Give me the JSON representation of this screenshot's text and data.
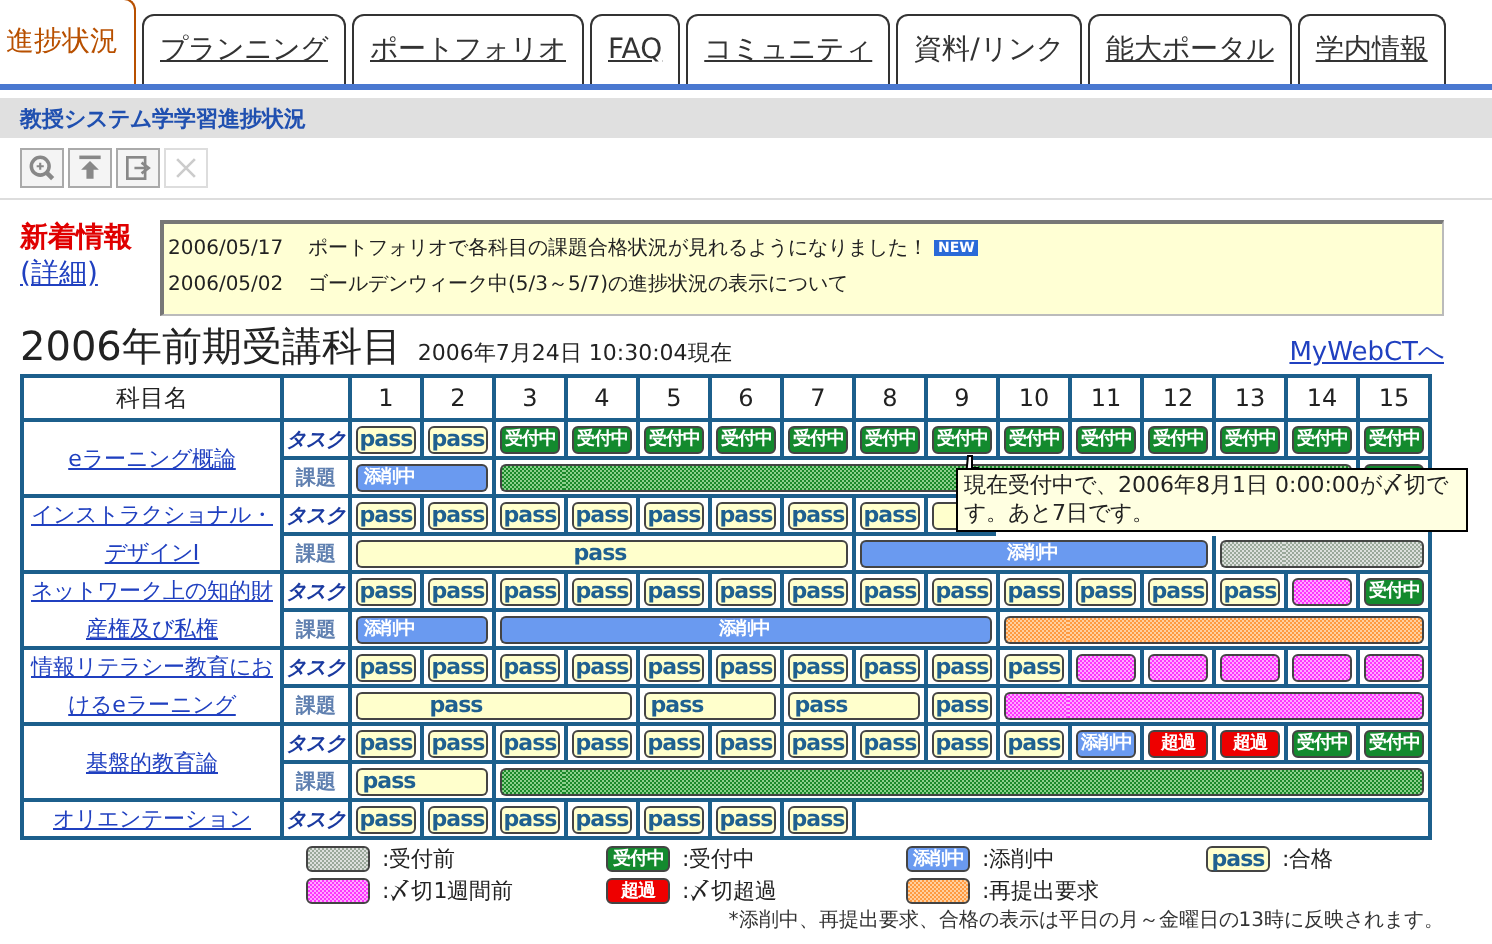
{
  "tabs": [
    {
      "label": "進捗状況",
      "selected": true,
      "linked": false
    },
    {
      "label": "プランニング",
      "selected": false,
      "linked": true
    },
    {
      "label": "ポートフォリオ",
      "selected": false,
      "linked": true
    },
    {
      "label": "FAQ",
      "selected": false,
      "linked": true
    },
    {
      "label": "コミュニティ",
      "selected": false,
      "linked": true
    },
    {
      "label": "資料/リンク",
      "selected": false,
      "linked": false
    },
    {
      "label": "能大ポータル",
      "selected": false,
      "linked": true
    },
    {
      "label": "学内情報",
      "selected": false,
      "linked": true
    }
  ],
  "header": {
    "title": "教授システム学学習進捗状況"
  },
  "toolbar": [
    {
      "kind": "zoom",
      "disabled": false
    },
    {
      "kind": "top",
      "disabled": false
    },
    {
      "kind": "export",
      "disabled": false
    },
    {
      "kind": "delete",
      "disabled": true
    }
  ],
  "news": {
    "title": "新着情報",
    "detail_link": "(詳細)",
    "items": [
      {
        "date": "2006/05/17",
        "text": "ポートフォリオで各科目の課題合格状況が見れるようになりました！",
        "badge": "NEW"
      },
      {
        "date": "2006/05/02",
        "text": "ゴールデンウィーク中(5/3～5/7)の進捗状況の表示について"
      }
    ]
  },
  "heading": {
    "title": "2006年前期受講科目",
    "timestamp": "2006年7月24日 10:30:04現在",
    "link": "MyWebCTへ"
  },
  "table": {
    "subject_header": "科目名",
    "weeks": [
      "1",
      "2",
      "3",
      "4",
      "5",
      "6",
      "7",
      "8",
      "9",
      "10",
      "11",
      "12",
      "13",
      "14",
      "15"
    ],
    "subjects": [
      {
        "name": "eラーニング概論",
        "rows": [
          {
            "kind": "task",
            "label": "タスク",
            "cells": [
              {
                "kind": "pass",
                "label": "pass",
                "joined": false
              },
              {
                "kind": "pass",
                "label": "pass",
                "joined": false
              },
              {
                "kind": "open",
                "label": "受付中",
                "joined": false
              },
              {
                "kind": "open",
                "label": "受付中",
                "joined": false
              },
              {
                "kind": "open",
                "label": "受付中",
                "joined": false
              },
              {
                "kind": "open",
                "label": "受付中",
                "joined": false
              },
              {
                "kind": "open",
                "label": "受付中",
                "joined": false
              },
              {
                "kind": "open",
                "label": "受付中",
                "joined": false
              },
              {
                "kind": "open",
                "label": "受付中",
                "joined": false
              },
              {
                "kind": "open",
                "label": "受付中",
                "joined": false
              },
              {
                "kind": "open",
                "label": "受付中",
                "joined": false
              },
              {
                "kind": "open",
                "label": "受付中",
                "joined": false
              },
              {
                "kind": "open",
                "label": "受付中",
                "joined": false
              },
              {
                "kind": "open",
                "label": "受付中",
                "joined": false
              },
              {
                "kind": "open",
                "label": "受付中",
                "joined": false
              }
            ]
          },
          {
            "kind": "assignment",
            "label": "課題",
            "cells": [
              {
                "kind": "grading",
                "label": "添削中",
                "joined": false
              },
              {
                "kind": "grading",
                "joined": true
              },
              {
                "kind": "open-period",
                "joined": false
              },
              {
                "kind": "open-period",
                "joined": true
              },
              {
                "kind": "open-period",
                "joined": true
              },
              {
                "kind": "open-period",
                "joined": true
              },
              {
                "kind": "open-period",
                "joined": true
              },
              {
                "kind": "open-period",
                "joined": true
              },
              {
                "kind": "open-period",
                "joined": true
              },
              {
                "kind": "open-period",
                "joined": true
              },
              {
                "kind": "open-period",
                "joined": true
              },
              {
                "kind": "open-period",
                "joined": true
              },
              {
                "kind": "open-period",
                "joined": true
              },
              {
                "kind": "open-period",
                "joined": true
              },
              {
                "kind": "open",
                "joined": false
              }
            ]
          }
        ]
      },
      {
        "name": "インストラクショナル・デザインⅠ",
        "rows": [
          {
            "kind": "task",
            "label": "タスク",
            "cells": [
              {
                "kind": "pass",
                "label": "pass",
                "joined": false
              },
              {
                "kind": "pass",
                "label": "pass",
                "joined": false
              },
              {
                "kind": "pass",
                "label": "pass",
                "joined": false
              },
              {
                "kind": "pass",
                "label": "pass",
                "joined": false
              },
              {
                "kind": "pass",
                "label": "pass",
                "joined": false
              },
              {
                "kind": "pass",
                "label": "pass",
                "joined": false
              },
              {
                "kind": "pass",
                "label": "pass",
                "joined": false
              },
              {
                "kind": "pass",
                "label": "pass",
                "joined": false
              },
              {
                "kind": "pass",
                "joined": false
              }
            ]
          },
          {
            "kind": "assignment",
            "label": "課題",
            "cells": [
              {
                "kind": "pass",
                "joined": false
              },
              {
                "kind": "pass",
                "joined": true
              },
              {
                "kind": "pass",
                "joined": true
              },
              {
                "kind": "pass",
                "label": "pass",
                "joined": true
              },
              {
                "kind": "pass",
                "joined": true
              },
              {
                "kind": "pass",
                "joined": true
              },
              {
                "kind": "pass",
                "joined": true
              },
              {
                "kind": "grading",
                "joined": false
              },
              {
                "kind": "grading",
                "joined": true
              },
              {
                "kind": "grading",
                "label": "添削中",
                "joined": true
              },
              {
                "kind": "grading",
                "joined": true
              },
              {
                "kind": "grading",
                "joined": true
              },
              {
                "kind": "before",
                "joined": false
              },
              {
                "kind": "before",
                "joined": true
              },
              {
                "kind": "before",
                "joined": true
              }
            ]
          }
        ]
      },
      {
        "name": "ネットワーク上の知的財産権及び私権",
        "rows": [
          {
            "kind": "task",
            "label": "タスク",
            "cells": [
              {
                "kind": "pass",
                "label": "pass",
                "joined": false
              },
              {
                "kind": "pass",
                "label": "pass",
                "joined": false
              },
              {
                "kind": "pass",
                "label": "pass",
                "joined": false
              },
              {
                "kind": "pass",
                "label": "pass",
                "joined": false
              },
              {
                "kind": "pass",
                "label": "pass",
                "joined": false
              },
              {
                "kind": "pass",
                "label": "pass",
                "joined": false
              },
              {
                "kind": "pass",
                "label": "pass",
                "joined": false
              },
              {
                "kind": "pass",
                "label": "pass",
                "joined": false
              },
              {
                "kind": "pass",
                "label": "pass",
                "joined": false
              },
              {
                "kind": "pass",
                "label": "pass",
                "joined": false
              },
              {
                "kind": "pass",
                "label": "pass",
                "joined": false
              },
              {
                "kind": "pass",
                "label": "pass",
                "joined": false
              },
              {
                "kind": "pass",
                "label": "pass",
                "joined": false
              },
              {
                "kind": "week",
                "joined": false
              },
              {
                "kind": "open",
                "label": "受付中",
                "joined": false
              }
            ]
          },
          {
            "kind": "assignment",
            "label": "課題",
            "cells": [
              {
                "kind": "grading",
                "label": "添削中",
                "joined": false
              },
              {
                "kind": "grading",
                "joined": true
              },
              {
                "kind": "grading",
                "joined": false
              },
              {
                "kind": "grading",
                "joined": true
              },
              {
                "kind": "grading",
                "joined": true
              },
              {
                "kind": "grading",
                "label": "添削中",
                "joined": true
              },
              {
                "kind": "grading",
                "joined": true
              },
              {
                "kind": "grading",
                "joined": true
              },
              {
                "kind": "grading",
                "joined": true
              },
              {
                "kind": "resubmit",
                "joined": false
              },
              {
                "kind": "resubmit",
                "joined": true
              },
              {
                "kind": "resubmit",
                "joined": true
              },
              {
                "kind": "resubmit",
                "joined": true
              },
              {
                "kind": "resubmit",
                "joined": true
              },
              {
                "kind": "resubmit",
                "joined": true
              }
            ]
          }
        ]
      },
      {
        "name": "情報リテラシー教育におけるeラーニング",
        "rows": [
          {
            "kind": "task",
            "label": "タスク",
            "cells": [
              {
                "kind": "pass",
                "label": "pass",
                "joined": false
              },
              {
                "kind": "pass",
                "label": "pass",
                "joined": false
              },
              {
                "kind": "pass",
                "label": "pass",
                "joined": false
              },
              {
                "kind": "pass",
                "label": "pass",
                "joined": false
              },
              {
                "kind": "pass",
                "label": "pass",
                "joined": false
              },
              {
                "kind": "pass",
                "label": "pass",
                "joined": false
              },
              {
                "kind": "pass",
                "label": "pass",
                "joined": false
              },
              {
                "kind": "pass",
                "label": "pass",
                "joined": false
              },
              {
                "kind": "pass",
                "label": "pass",
                "joined": false
              },
              {
                "kind": "pass",
                "label": "pass",
                "joined": false
              },
              {
                "kind": "week",
                "joined": false
              },
              {
                "kind": "week",
                "joined": false
              },
              {
                "kind": "week",
                "joined": false
              },
              {
                "kind": "week",
                "joined": false
              },
              {
                "kind": "week",
                "joined": false
              }
            ]
          },
          {
            "kind": "assignment",
            "label": "課題",
            "cells": [
              {
                "kind": "pass",
                "joined": false
              },
              {
                "kind": "pass",
                "label": "pass",
                "joined": true
              },
              {
                "kind": "pass",
                "joined": true
              },
              {
                "kind": "pass",
                "joined": true
              },
              {
                "kind": "pass",
                "label": "pass",
                "joined": false
              },
              {
                "kind": "pass",
                "joined": true
              },
              {
                "kind": "pass",
                "label": "pass",
                "joined": false
              },
              {
                "kind": "pass",
                "joined": true
              },
              {
                "kind": "pass",
                "label": "pass",
                "joined": false
              },
              {
                "kind": "week",
                "joined": false
              },
              {
                "kind": "week",
                "joined": true
              },
              {
                "kind": "week",
                "joined": true
              },
              {
                "kind": "week",
                "joined": true
              },
              {
                "kind": "week",
                "joined": true
              },
              {
                "kind": "week",
                "joined": true
              }
            ]
          }
        ]
      },
      {
        "name": "基盤的教育論",
        "rows": [
          {
            "kind": "task",
            "label": "タスク",
            "cells": [
              {
                "kind": "pass",
                "label": "pass",
                "joined": false
              },
              {
                "kind": "pass",
                "label": "pass",
                "joined": false
              },
              {
                "kind": "pass",
                "label": "pass",
                "joined": false
              },
              {
                "kind": "pass",
                "label": "pass",
                "joined": false
              },
              {
                "kind": "pass",
                "label": "pass",
                "joined": false
              },
              {
                "kind": "pass",
                "label": "pass",
                "joined": false
              },
              {
                "kind": "pass",
                "label": "pass",
                "joined": false
              },
              {
                "kind": "pass",
                "label": "pass",
                "joined": false
              },
              {
                "kind": "pass",
                "label": "pass",
                "joined": false
              },
              {
                "kind": "pass",
                "label": "pass",
                "joined": false
              },
              {
                "kind": "grading",
                "label": "添削中",
                "joined": false
              },
              {
                "kind": "over",
                "label": "超過",
                "joined": false
              },
              {
                "kind": "over",
                "label": "超過",
                "joined": false
              },
              {
                "kind": "open",
                "label": "受付中",
                "joined": false
              },
              {
                "kind": "open",
                "label": "受付中",
                "joined": false
              }
            ]
          },
          {
            "kind": "assignment",
            "label": "課題",
            "cells": [
              {
                "kind": "pass",
                "label": "pass",
                "joined": false
              },
              {
                "kind": "pass",
                "joined": true
              },
              {
                "kind": "open-period",
                "joined": false
              },
              {
                "kind": "open-period",
                "joined": true
              },
              {
                "kind": "open-period",
                "joined": true
              },
              {
                "kind": "open-period",
                "joined": true
              },
              {
                "kind": "open-period",
                "joined": true
              },
              {
                "kind": "open-period",
                "joined": true
              },
              {
                "kind": "open-period",
                "joined": true
              },
              {
                "kind": "open-period",
                "joined": true
              },
              {
                "kind": "open-period",
                "joined": true
              },
              {
                "kind": "open-period",
                "joined": true
              },
              {
                "kind": "open-period",
                "joined": true
              },
              {
                "kind": "open-period",
                "joined": true
              },
              {
                "kind": "open-period",
                "joined": true
              }
            ]
          }
        ]
      },
      {
        "name": "オリエンテーション",
        "rows": [
          {
            "kind": "task",
            "label": "タスク",
            "cells": [
              {
                "kind": "pass",
                "label": "pass",
                "joined": false
              },
              {
                "kind": "pass",
                "label": "pass",
                "joined": false
              },
              {
                "kind": "pass",
                "label": "pass",
                "joined": false
              },
              {
                "kind": "pass",
                "label": "pass",
                "joined": false
              },
              {
                "kind": "pass",
                "label": "pass",
                "joined": false
              },
              {
                "kind": "pass",
                "label": "pass",
                "joined": false
              },
              {
                "kind": "pass",
                "label": "pass",
                "joined": false
              },
              {
                "kind": "empty",
                "joined": false
              },
              {
                "kind": "empty",
                "joined": true
              },
              {
                "kind": "empty",
                "joined": true
              },
              {
                "kind": "empty",
                "joined": true
              },
              {
                "kind": "empty",
                "joined": true
              },
              {
                "kind": "empty",
                "joined": true
              },
              {
                "kind": "empty",
                "joined": true
              },
              {
                "kind": "empty",
                "joined": true
              }
            ]
          }
        ]
      }
    ]
  },
  "tooltip": {
    "text": "現在受付中で、2006年8月1日 0:00:00が〆切です。あと7日です。"
  },
  "legend": [
    {
      "kind": "before",
      "label": ":受付前"
    },
    {
      "kind": "open",
      "chip": "受付中",
      "label": ":受付中"
    },
    {
      "kind": "grading",
      "chip": "添削中",
      "label": ":添削中"
    },
    {
      "kind": "pass",
      "chip": "pass",
      "label": ":合格"
    },
    {
      "kind": "week",
      "label": ":〆切1週間前"
    },
    {
      "kind": "over",
      "chip": "超過",
      "label": ":〆切超過"
    },
    {
      "kind": "resubmit",
      "label": ":再提出要求"
    }
  ],
  "footnote": "*添削中、再提出要求、合格の表示は平日の月～金曜日の13時に反映されます。"
}
